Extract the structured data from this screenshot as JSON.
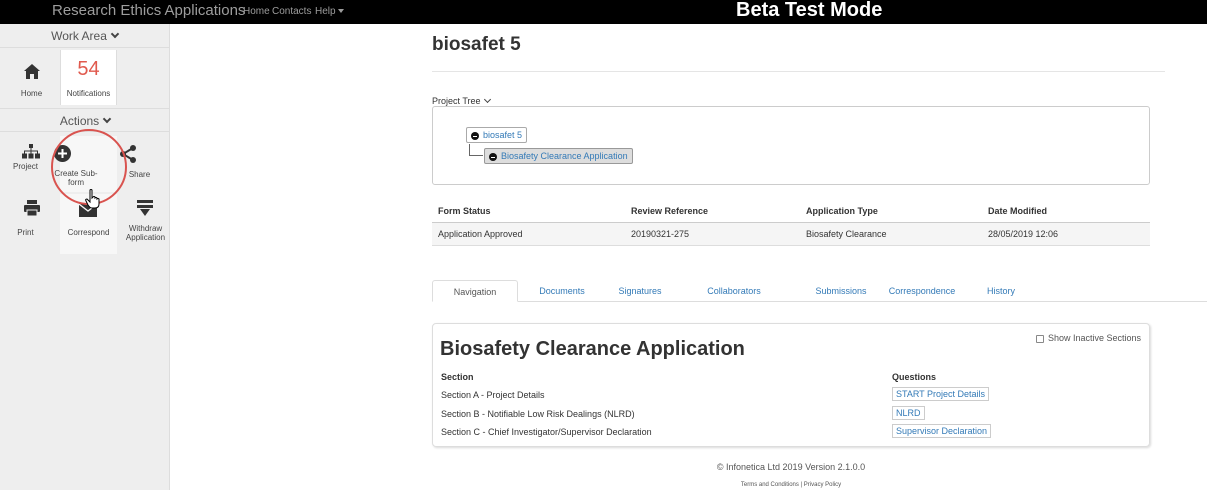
{
  "topbar": {
    "brand": "Research Ethics Applications",
    "nav": [
      "Home",
      "Contacts",
      "Help"
    ],
    "beta": "Beta Test Mode"
  },
  "sidebar": {
    "work_area": "Work Area",
    "home_label": "Home",
    "notifications_count": "54",
    "notifications_label": "Notifications",
    "actions": "Actions",
    "project_label": "Project",
    "create_subform_label": "Create Sub-form",
    "share_label": "Share",
    "print_label": "Print",
    "correspond_label": "Correspond",
    "withdraw_label": "Withdraw Application"
  },
  "main": {
    "title": "biosafet 5",
    "project_tree_label": "Project Tree",
    "tree": {
      "root": "biosafet 5",
      "child": "Biosafety Clearance Application"
    },
    "status": {
      "headers": [
        "Form Status",
        "Review Reference",
        "Application Type",
        "Date Modified"
      ],
      "row": [
        "Application Approved",
        "20190321-275",
        "Biosafety Clearance",
        "28/05/2019 12:06"
      ]
    },
    "tabs": [
      "Navigation",
      "Documents",
      "Signatures",
      "Collaborators",
      "Submissions",
      "Correspondence",
      "History"
    ],
    "panel": {
      "heading": "Biosafety Clearance Application",
      "show_inactive": "Show Inactive Sections",
      "section_header": "Section",
      "questions_header": "Questions",
      "sections": [
        {
          "name": "Section A - Project Details",
          "button": "START Project Details"
        },
        {
          "name": "Section B - Notifiable Low Risk Dealings (NLRD)",
          "button": "NLRD"
        },
        {
          "name": "Section C - Chief Investigator/Supervisor Declaration",
          "button": "Supervisor Declaration"
        }
      ]
    },
    "footer": {
      "version": "© Infonetica Ltd 2019 Version 2.1.0.0",
      "links": "Terms and Conditions | Privacy Policy"
    }
  },
  "colors": {
    "topbar": "#000000",
    "link": "#337ab7",
    "notification": "#e05a4e",
    "highlight_ring": "#d9534f"
  }
}
